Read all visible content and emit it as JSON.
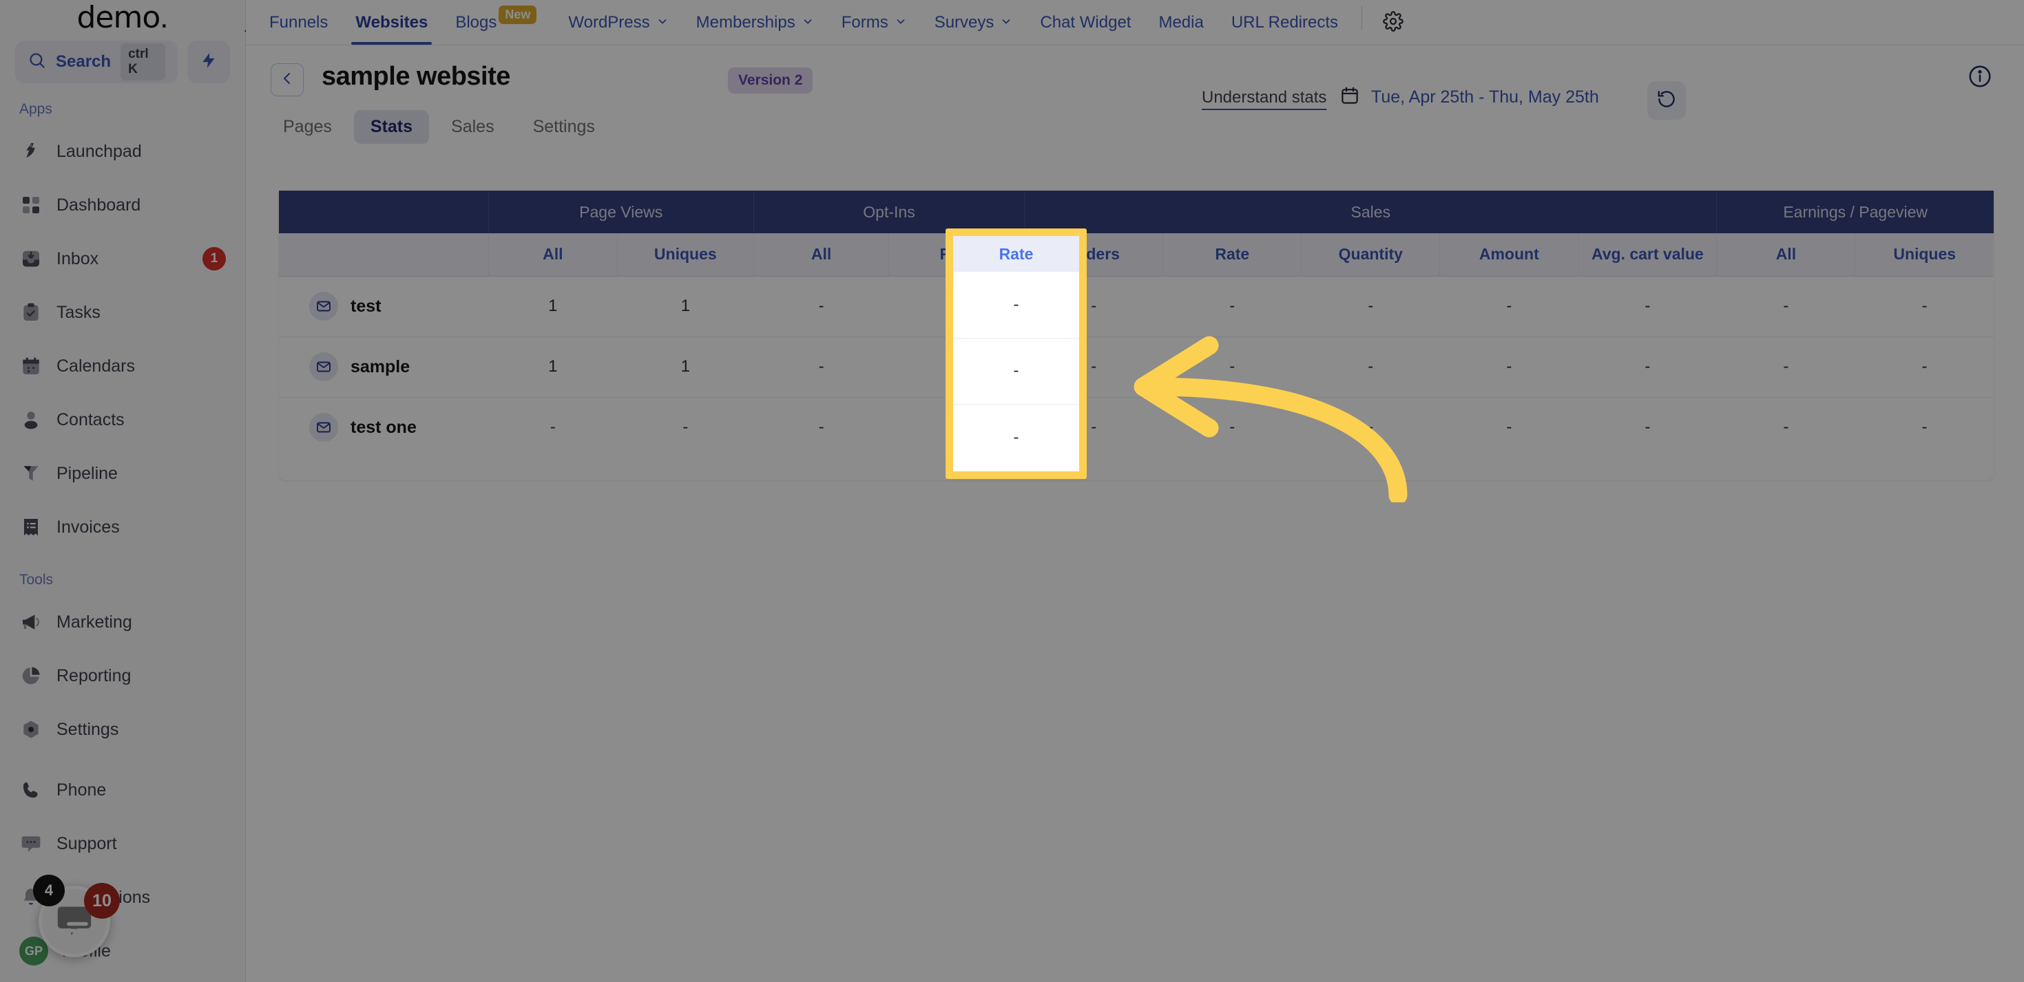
{
  "brand": {
    "name": "demo",
    "dot": "."
  },
  "search": {
    "label": "Search",
    "shortcut": "ctrl K"
  },
  "sidebar": {
    "section_apps": "Apps",
    "section_tools": "Tools",
    "apps": [
      {
        "label": "Launchpad",
        "icon": "launchpad-icon",
        "badge": ""
      },
      {
        "label": "Dashboard",
        "icon": "dashboard-icon",
        "badge": ""
      },
      {
        "label": "Inbox",
        "icon": "inbox-icon",
        "badge": "1"
      },
      {
        "label": "Tasks",
        "icon": "tasks-icon",
        "badge": ""
      },
      {
        "label": "Calendars",
        "icon": "calendar-icon",
        "badge": ""
      },
      {
        "label": "Contacts",
        "icon": "contacts-icon",
        "badge": ""
      },
      {
        "label": "Pipeline",
        "icon": "pipeline-icon",
        "badge": ""
      },
      {
        "label": "Invoices",
        "icon": "invoices-icon",
        "badge": ""
      }
    ],
    "tools": [
      {
        "label": "Marketing",
        "icon": "megaphone-icon",
        "badge": ""
      },
      {
        "label": "Reporting",
        "icon": "pie-chart-icon",
        "badge": ""
      },
      {
        "label": "Settings",
        "icon": "settings-icon",
        "badge": ""
      }
    ],
    "bottom": [
      {
        "label": "Phone",
        "icon": "phone-icon",
        "badge": ""
      },
      {
        "label": "Support",
        "icon": "support-icon",
        "badge": ""
      },
      {
        "label": "Notifications",
        "icon": "bell-icon",
        "badge": ""
      },
      {
        "label": "Profile",
        "icon": "avatar",
        "badge": ""
      }
    ],
    "profile_initials": "GP",
    "chat_badge_dark": "4",
    "chat_badge_red": "10"
  },
  "topnav": {
    "items": [
      {
        "label": "Funnels",
        "caret": false,
        "active": false,
        "tag": ""
      },
      {
        "label": "Websites",
        "caret": false,
        "active": true,
        "tag": ""
      },
      {
        "label": "Blogs",
        "caret": false,
        "active": false,
        "tag": "New"
      },
      {
        "label": "WordPress",
        "caret": true,
        "active": false,
        "tag": ""
      },
      {
        "label": "Memberships",
        "caret": true,
        "active": false,
        "tag": ""
      },
      {
        "label": "Forms",
        "caret": true,
        "active": false,
        "tag": ""
      },
      {
        "label": "Surveys",
        "caret": true,
        "active": false,
        "tag": ""
      },
      {
        "label": "Chat Widget",
        "caret": false,
        "active": false,
        "tag": ""
      },
      {
        "label": "Media",
        "caret": false,
        "active": false,
        "tag": ""
      },
      {
        "label": "URL Redirects",
        "caret": false,
        "active": false,
        "tag": ""
      }
    ]
  },
  "header": {
    "title": "sample website",
    "version_badge": "Version 2",
    "understand_stats": "Understand stats",
    "date_range": "Tue, Apr 25th - Thu, May 25th"
  },
  "tabs": [
    {
      "label": "Pages",
      "active": false
    },
    {
      "label": "Stats",
      "active": true
    },
    {
      "label": "Sales",
      "active": false
    },
    {
      "label": "Settings",
      "active": false
    }
  ],
  "table": {
    "groups": [
      {
        "label": "",
        "span": 1
      },
      {
        "label": "Page Views",
        "span": 2
      },
      {
        "label": "Opt-Ins",
        "span": 2
      },
      {
        "label": "Sales",
        "span": 5
      },
      {
        "label": "Earnings / Pageview",
        "span": 2
      }
    ],
    "subheaders": [
      "",
      "All",
      "Uniques",
      "All",
      "Rate",
      "Orders",
      "Rate",
      "Quantity",
      "Amount",
      "Avg. cart value",
      "All",
      "Uniques"
    ],
    "highlighted_column": "Rate",
    "rows": [
      {
        "name": "test",
        "icon": "mail-icon",
        "values": [
          "1",
          "1",
          "-",
          "-",
          "-",
          "-",
          "-",
          "-",
          "-",
          "-",
          "-"
        ]
      },
      {
        "name": "sample",
        "icon": "mail-icon",
        "values": [
          "1",
          "1",
          "-",
          "-",
          "-",
          "-",
          "-",
          "-",
          "-",
          "-",
          "-"
        ]
      },
      {
        "name": "test one",
        "icon": "mail-icon",
        "values": [
          "-",
          "-",
          "-",
          "-",
          "-",
          "-",
          "-",
          "-",
          "-",
          "-",
          "-"
        ]
      }
    ]
  },
  "annotation": {
    "arrow_color": "#fcd051",
    "highlight_color": "#fcd051",
    "points_to": "Rate"
  },
  "colors": {
    "accent": "#3b56b5",
    "table_header": "#33417e",
    "highlight": "#fcd051",
    "badge_red": "#d9322a",
    "new_tag": "#dfa92c"
  }
}
